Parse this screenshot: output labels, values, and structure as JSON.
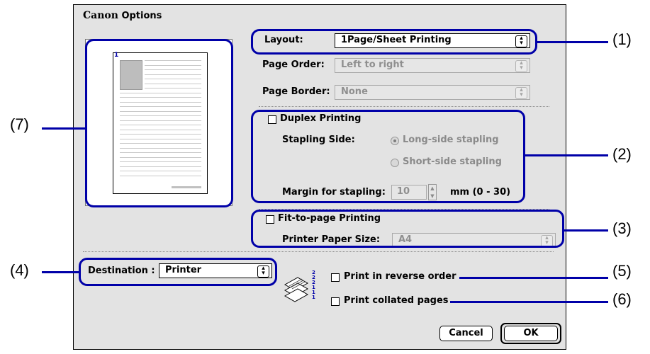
{
  "window": {
    "brand": "Canon",
    "title": "Options"
  },
  "layout": {
    "label": "Layout:",
    "value": "1Page/Sheet Printing"
  },
  "page_order": {
    "label": "Page Order:",
    "value": "Left to right"
  },
  "page_border": {
    "label": "Page Border:",
    "value": "None"
  },
  "duplex": {
    "label": "Duplex Printing"
  },
  "stapling": {
    "label": "Stapling Side:",
    "long": "Long-side stapling",
    "short": "Short-side stapling"
  },
  "margin": {
    "label": "Margin for stapling:",
    "value": "10",
    "unit": "mm (0 - 30)"
  },
  "fit_to_page": {
    "label": "Fit-to-page Printing",
    "paper_label": "Printer Paper Size:",
    "paper_value": "A4"
  },
  "destination": {
    "label": "Destination :",
    "value": "Printer"
  },
  "reverse_order": {
    "label": "Print in reverse order"
  },
  "collated": {
    "label": "Print collated pages"
  },
  "preview": {
    "page_number": "1",
    "stack_digits": "2 2 2 1 1 1"
  },
  "buttons": {
    "cancel": "Cancel",
    "ok": "OK"
  },
  "callouts": {
    "c1": "(1)",
    "c2": "(2)",
    "c3": "(3)",
    "c4": "(4)",
    "c5": "(5)",
    "c6": "(6)",
    "c7": "(7)"
  },
  "colors": {
    "callout": "#0000a8",
    "dialog_bg": "#e3e3e3"
  }
}
